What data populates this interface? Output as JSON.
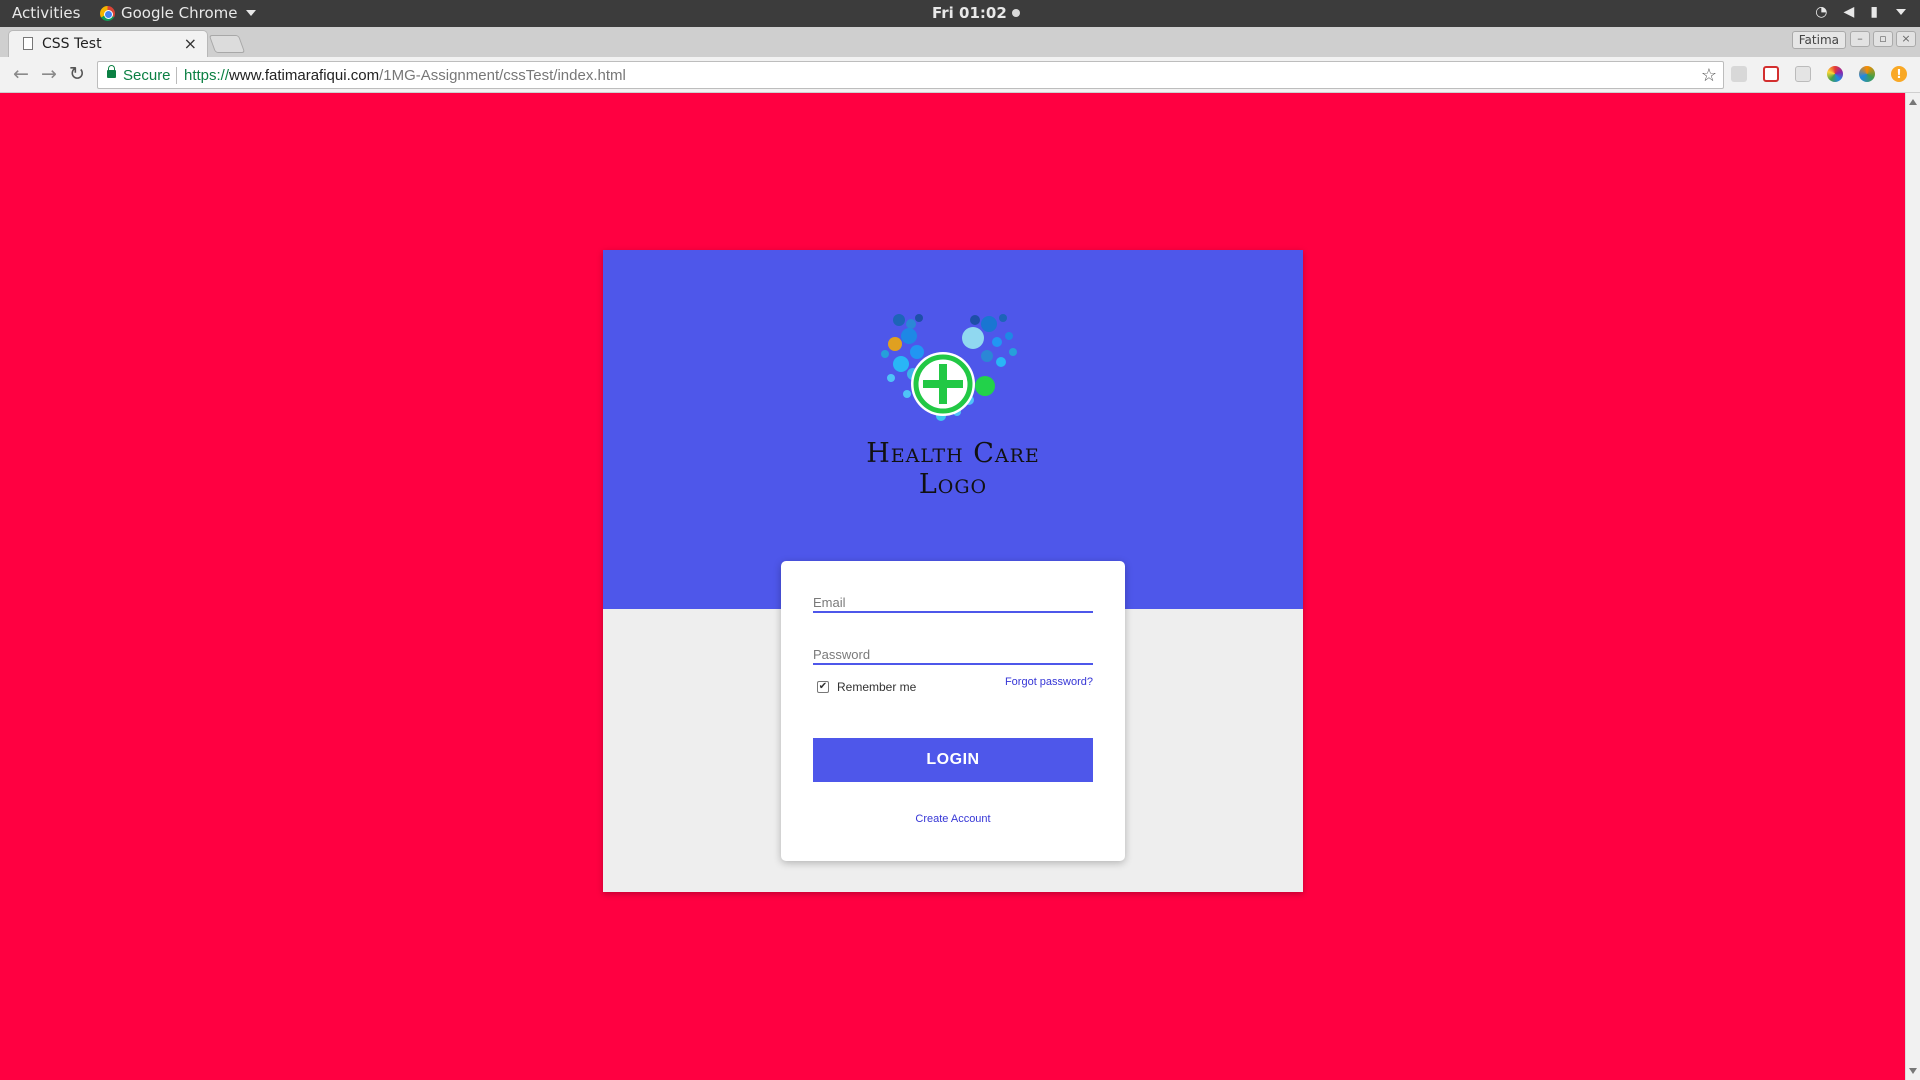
{
  "os_bar": {
    "activities": "Activities",
    "app_name": "Google Chrome",
    "clock": "Fri 01:02"
  },
  "browser": {
    "tab_title": "CSS Test",
    "tab_close": "×",
    "profile_name": "Fatima",
    "secure_label": "Secure",
    "url_scheme": "https://",
    "url_host": "www.fatimarafiqui.com",
    "url_path": "/1MG-Assignment/cssTest/index.html"
  },
  "page": {
    "background_color": "#ff0041",
    "accent_color": "#4e57ea",
    "logo": {
      "line1": "Health Care",
      "line2": "Logo",
      "cross_color": "#22c845"
    },
    "form": {
      "email_placeholder": "Email",
      "password_placeholder": "Password",
      "remember_label": "Remember me",
      "remember_checked": true,
      "forgot_link": "Forgot password?",
      "login_button": "LOGIN",
      "create_link": "Create Account"
    }
  }
}
